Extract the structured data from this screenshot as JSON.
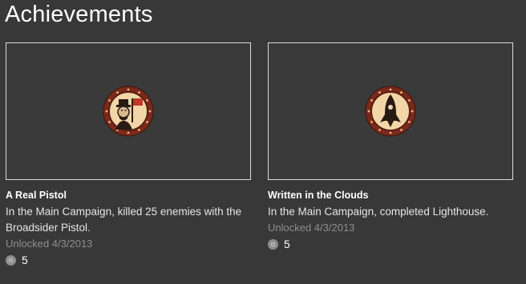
{
  "page": {
    "title": "Achievements"
  },
  "achievements": [
    {
      "name": "A Real Pistol",
      "description": "In the Main Campaign, killed 25 enemies with the Broadsider Pistol.",
      "unlocked": "Unlocked 4/3/2013",
      "gamerscore": "5",
      "icon": "portrait-with-flag-emblem"
    },
    {
      "name": "Written in the Clouds",
      "description": "In the Main Campaign, completed Lighthouse.",
      "unlocked": "Unlocked 4/3/2013",
      "gamerscore": "5",
      "icon": "rocket-emblem"
    }
  ],
  "colors": {
    "background": "#383838",
    "emblem_outer": "#7a2a1a",
    "emblem_inner": "#f2d6a8",
    "emblem_figure": "#2a1a14",
    "flag": "#c0392b"
  }
}
